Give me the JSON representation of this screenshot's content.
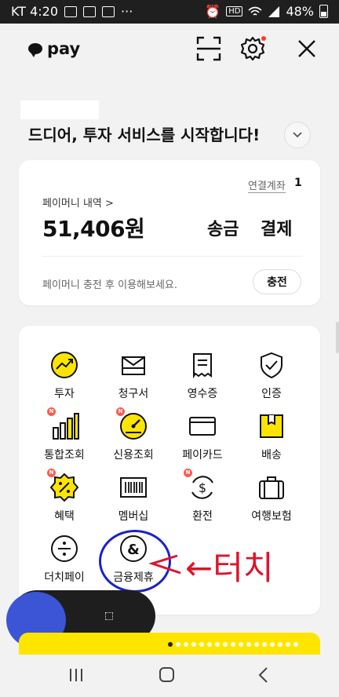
{
  "status_bar": {
    "carrier_time": "KT 4:20",
    "more": "···",
    "hd": "HD",
    "battery": "48%"
  },
  "app": {
    "logo_text": "pay"
  },
  "headline": "드디어, 투자 서비스를 시작합니다!",
  "money_card": {
    "linked_account_label": "연결계좌",
    "linked_account_count": "1",
    "history_label": "페이머니 내역 >",
    "balance": "51,406원",
    "send_label": "송금",
    "pay_label": "결제",
    "hint": "페이머니 충전 후 이용해보세요.",
    "charge_label": "충전"
  },
  "menu": [
    {
      "label": "투자",
      "icon": "investment-icon",
      "badge": ""
    },
    {
      "label": "청구서",
      "icon": "bill-icon",
      "badge": ""
    },
    {
      "label": "영수증",
      "icon": "receipt-icon",
      "badge": ""
    },
    {
      "label": "인증",
      "icon": "shield-check-icon",
      "badge": ""
    },
    {
      "label": "통합조회",
      "icon": "bar-chart-icon",
      "badge": "N"
    },
    {
      "label": "신용조회",
      "icon": "gauge-icon",
      "badge": "N"
    },
    {
      "label": "페이카드",
      "icon": "card-icon",
      "badge": ""
    },
    {
      "label": "배송",
      "icon": "box-icon",
      "badge": ""
    },
    {
      "label": "혜택",
      "icon": "discount-badge-icon",
      "badge": "N"
    },
    {
      "label": "멤버십",
      "icon": "barcode-icon",
      "badge": ""
    },
    {
      "label": "환전",
      "icon": "currency-exchange-icon",
      "badge": "N"
    },
    {
      "label": "여행보험",
      "icon": "suitcase-icon",
      "badge": ""
    },
    {
      "label": "더치페이",
      "icon": "divide-icon",
      "badge": ""
    },
    {
      "label": "금융제휴",
      "icon": "ampersand-icon",
      "badge": ""
    }
  ],
  "annotation": {
    "handwritten": "←터치"
  },
  "colors": {
    "accent": "#fee500",
    "badge": "#ff5a4d",
    "annotation": "#e0132b",
    "circle": "#1a22c9"
  }
}
